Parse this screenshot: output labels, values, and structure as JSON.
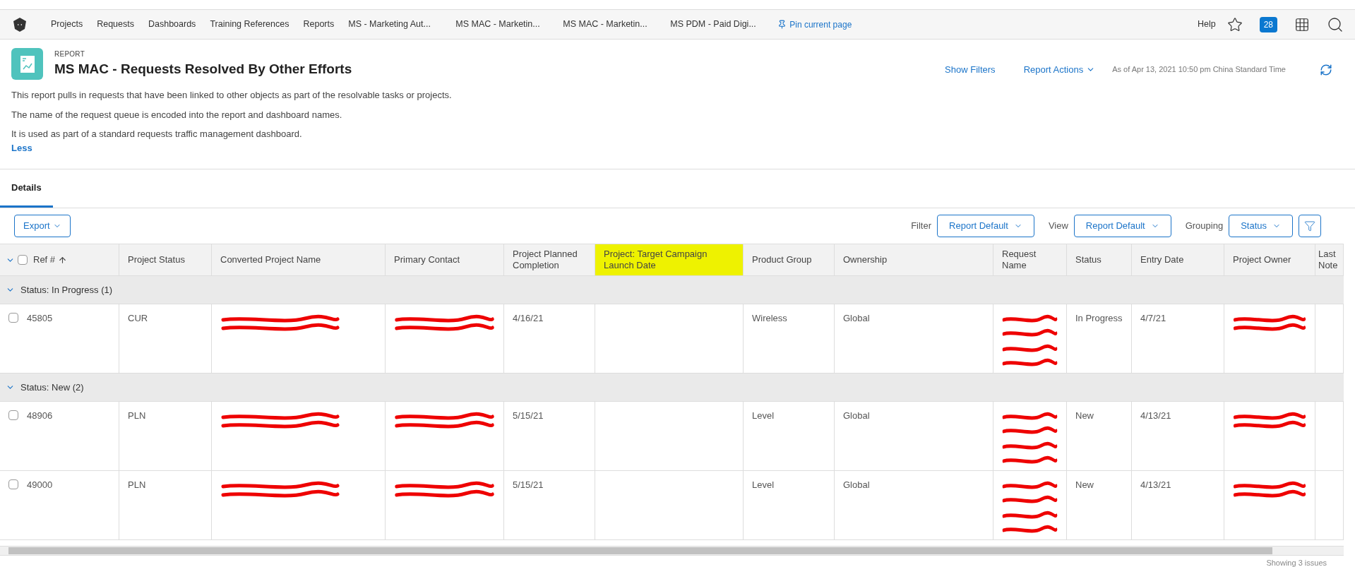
{
  "nav": {
    "items": [
      {
        "label": "Projects"
      },
      {
        "label": "Requests"
      },
      {
        "label": "Dashboards"
      },
      {
        "label": "Training References"
      },
      {
        "label": "Reports"
      },
      {
        "label": "MS - Marketing Aut..."
      },
      {
        "label": "MS MAC - Marketin..."
      },
      {
        "label": "MS MAC - Marketin..."
      },
      {
        "label": "MS PDM - Paid Digi..."
      }
    ],
    "pin": "Pin current page",
    "help": "Help",
    "badge": "28"
  },
  "report": {
    "kicker": "REPORT",
    "title": "MS MAC - Requests Resolved By Other Efforts",
    "show_filters": "Show Filters",
    "actions": "Report Actions",
    "as_of": "As of Apr 13, 2021 10:50 pm China Standard Time",
    "description": [
      "This report pulls in requests that have been linked to other objects as part of the resolvable tasks or projects.",
      "The name of the request queue is encoded into the report and dashboard names.",
      "It is used as part of a standard requests traffic management dashboard."
    ],
    "less": "Less"
  },
  "tabs": [
    {
      "label": "Details",
      "selected": true
    }
  ],
  "toolbar": {
    "export": "Export",
    "filter_label": "Filter",
    "filter": "Report Default",
    "view_label": "View",
    "view": "Report Default",
    "grouping_label": "Grouping",
    "grouping": "Status"
  },
  "table": {
    "select_all": {
      "checked": false
    },
    "columns": [
      {
        "label": "Ref #",
        "highlighted": false
      },
      {
        "label": "Project Status",
        "highlighted": false
      },
      {
        "label": "Converted Project Name",
        "highlighted": false
      },
      {
        "label": "Primary Contact",
        "highlighted": false
      },
      {
        "label": "Project Planned Completion",
        "highlighted": false
      },
      {
        "label": "Project: Target Campaign Launch Date",
        "highlighted": true
      },
      {
        "label": "Product Group",
        "highlighted": false
      },
      {
        "label": "Ownership",
        "highlighted": false
      },
      {
        "label": "Request Name",
        "highlighted": false
      },
      {
        "label": "Status",
        "highlighted": false
      },
      {
        "label": "Entry Date",
        "highlighted": false
      },
      {
        "label": "Project Owner",
        "highlighted": false
      },
      {
        "label": "Last Note",
        "highlighted": false
      }
    ],
    "groups": [
      {
        "label": "Status: In Progress (1)",
        "expanded": true,
        "rows": [
          {
            "checked": false,
            "cells": [
              {
                "kind": "text",
                "text": "45805"
              },
              {
                "kind": "text",
                "text": "CUR"
              },
              {
                "kind": "redacted"
              },
              {
                "kind": "redacted"
              },
              {
                "kind": "text",
                "text": "4/16/21"
              },
              {
                "kind": "empty"
              },
              {
                "kind": "text",
                "text": "Wireless"
              },
              {
                "kind": "text",
                "text": "Global"
              },
              {
                "kind": "redacted"
              },
              {
                "kind": "text",
                "text": "In Progress"
              },
              {
                "kind": "text",
                "text": "4/7/21"
              },
              {
                "kind": "redacted"
              },
              {
                "kind": "empty"
              }
            ]
          }
        ]
      },
      {
        "label": "Status: New (2)",
        "expanded": true,
        "rows": [
          {
            "checked": false,
            "cells": [
              {
                "kind": "text",
                "text": "48906"
              },
              {
                "kind": "text",
                "text": "PLN"
              },
              {
                "kind": "redacted"
              },
              {
                "kind": "redacted"
              },
              {
                "kind": "text",
                "text": "5/15/21"
              },
              {
                "kind": "empty"
              },
              {
                "kind": "text",
                "text": "Level"
              },
              {
                "kind": "text",
                "text": "Global"
              },
              {
                "kind": "redacted"
              },
              {
                "kind": "text",
                "text": "New"
              },
              {
                "kind": "text",
                "text": "4/13/21"
              },
              {
                "kind": "redacted"
              },
              {
                "kind": "empty"
              }
            ]
          },
          {
            "checked": false,
            "cells": [
              {
                "kind": "text",
                "text": "49000"
              },
              {
                "kind": "text",
                "text": "PLN"
              },
              {
                "kind": "redacted"
              },
              {
                "kind": "redacted"
              },
              {
                "kind": "text",
                "text": "5/15/21"
              },
              {
                "kind": "empty"
              },
              {
                "kind": "text",
                "text": "Level"
              },
              {
                "kind": "text",
                "text": "Global"
              },
              {
                "kind": "redacted"
              },
              {
                "kind": "text",
                "text": "New"
              },
              {
                "kind": "text",
                "text": "4/13/21"
              },
              {
                "kind": "redacted"
              },
              {
                "kind": "empty"
              }
            ]
          }
        ]
      }
    ]
  },
  "footer": "Showing 3 issues"
}
